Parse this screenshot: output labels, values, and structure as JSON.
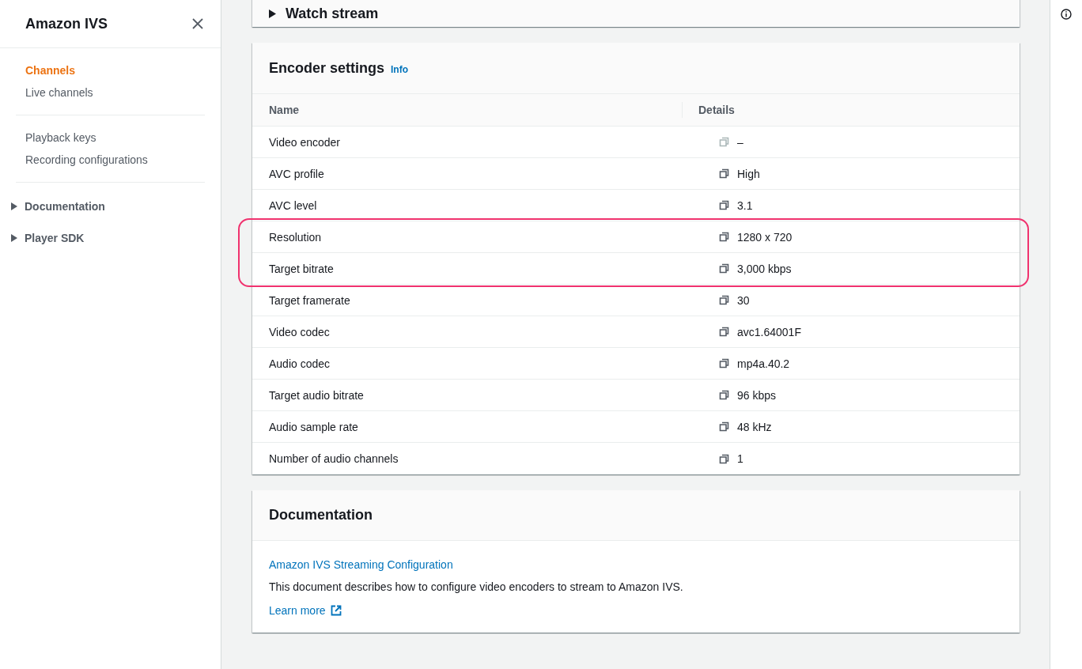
{
  "sidebar": {
    "title": "Amazon IVS",
    "groups": [
      {
        "items": [
          {
            "label": "Channels",
            "selected": true
          },
          {
            "label": "Live channels",
            "selected": false
          }
        ]
      },
      {
        "items": [
          {
            "label": "Playback keys",
            "selected": false
          },
          {
            "label": "Recording configurations",
            "selected": false
          }
        ]
      }
    ],
    "sections": [
      {
        "label": "Documentation",
        "expanded": false
      },
      {
        "label": "Player SDK",
        "expanded": false
      }
    ]
  },
  "watch_stream": {
    "title": "Watch stream",
    "expanded": false
  },
  "encoder_settings": {
    "title": "Encoder settings",
    "info_link": "Info",
    "columns": [
      "Name",
      "Details"
    ],
    "rows": [
      {
        "name": "Video encoder",
        "details": "–",
        "copyable": false,
        "highlighted": false
      },
      {
        "name": "AVC profile",
        "details": "High",
        "copyable": true,
        "highlighted": false
      },
      {
        "name": "AVC level",
        "details": "3.1",
        "copyable": true,
        "highlighted": false
      },
      {
        "name": "Resolution",
        "details": "1280 x 720",
        "copyable": true,
        "highlighted": true
      },
      {
        "name": "Target bitrate",
        "details": "3,000 kbps",
        "copyable": true,
        "highlighted": true
      },
      {
        "name": "Target framerate",
        "details": "30",
        "copyable": true,
        "highlighted": false
      },
      {
        "name": "Video codec",
        "details": "avc1.64001F",
        "copyable": true,
        "highlighted": false
      },
      {
        "name": "Audio codec",
        "details": "mp4a.40.2",
        "copyable": true,
        "highlighted": false
      },
      {
        "name": "Target audio bitrate",
        "details": "96 kbps",
        "copyable": true,
        "highlighted": false
      },
      {
        "name": "Audio sample rate",
        "details": "48 kHz",
        "copyable": true,
        "highlighted": false
      },
      {
        "name": "Number of audio channels",
        "details": "1",
        "copyable": true,
        "highlighted": false
      }
    ]
  },
  "documentation": {
    "title": "Documentation",
    "link": "Amazon IVS Streaming Configuration",
    "description": "This document describes how to configure video encoders to stream to Amazon IVS.",
    "learn_more": "Learn more"
  }
}
